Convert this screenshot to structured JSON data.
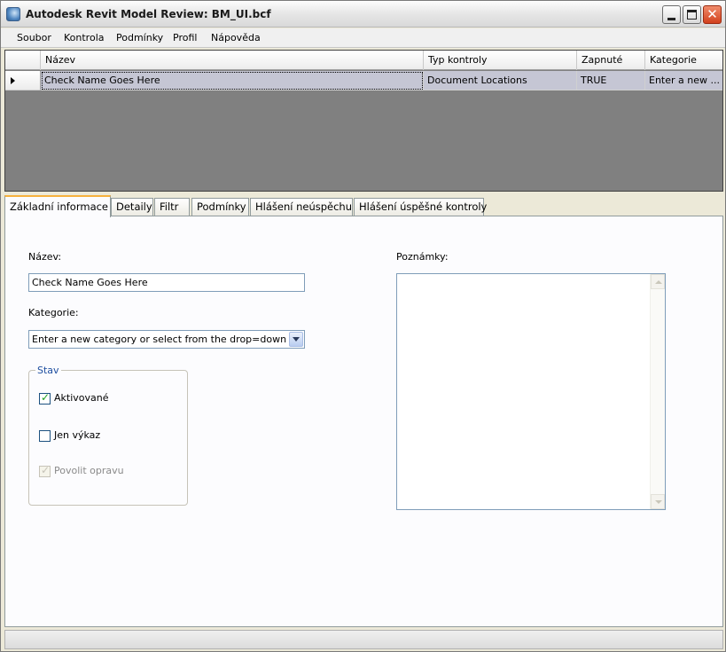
{
  "window": {
    "title": "Autodesk Revit Model Review: BM_UI.bcf",
    "app_icon": "revit-model-review-icon",
    "buttons": {
      "minimize": "minimize-icon",
      "maximize": "maximize-icon",
      "close": "✕"
    }
  },
  "menu": {
    "items": [
      "Soubor",
      "Kontrola",
      "Podmínky",
      "Profil",
      "Nápověda"
    ]
  },
  "grid": {
    "columns": [
      "Název",
      "Typ kontroly",
      "Zapnuté",
      "Kategorie"
    ],
    "rows": [
      {
        "name": "Check Name Goes Here",
        "type": "Document Locations",
        "enabled": "TRUE",
        "category": "Enter a new ..."
      }
    ]
  },
  "tabs": [
    {
      "label": "Základní informace",
      "active": true
    },
    {
      "label": "Detaily",
      "active": false
    },
    {
      "label": "Filtr",
      "active": false
    },
    {
      "label": "Podmínky",
      "active": false
    },
    {
      "label": "Hlášení neúspěchu",
      "active": false
    },
    {
      "label": "Hlášení úspěšné kontroly",
      "active": false
    }
  ],
  "form": {
    "name_label": "Název:",
    "name_value": "Check Name Goes Here",
    "category_label": "Kategorie:",
    "category_value": "Enter a new category or select from the drop=down li",
    "status_group": "Stav",
    "activated_label": "Aktivované",
    "activated_checked": true,
    "report_only_label": "Jen výkaz",
    "report_only_checked": false,
    "allow_fix_label": "Povolit opravu",
    "allow_fix_checked": true,
    "notes_label": "Poznámky:",
    "notes_value": ""
  },
  "colors": {
    "grid_background": "#808080",
    "selected_row": "#c5c6d4",
    "active_tab_accent": "#f6b13d",
    "checkmark": "#21a121"
  }
}
